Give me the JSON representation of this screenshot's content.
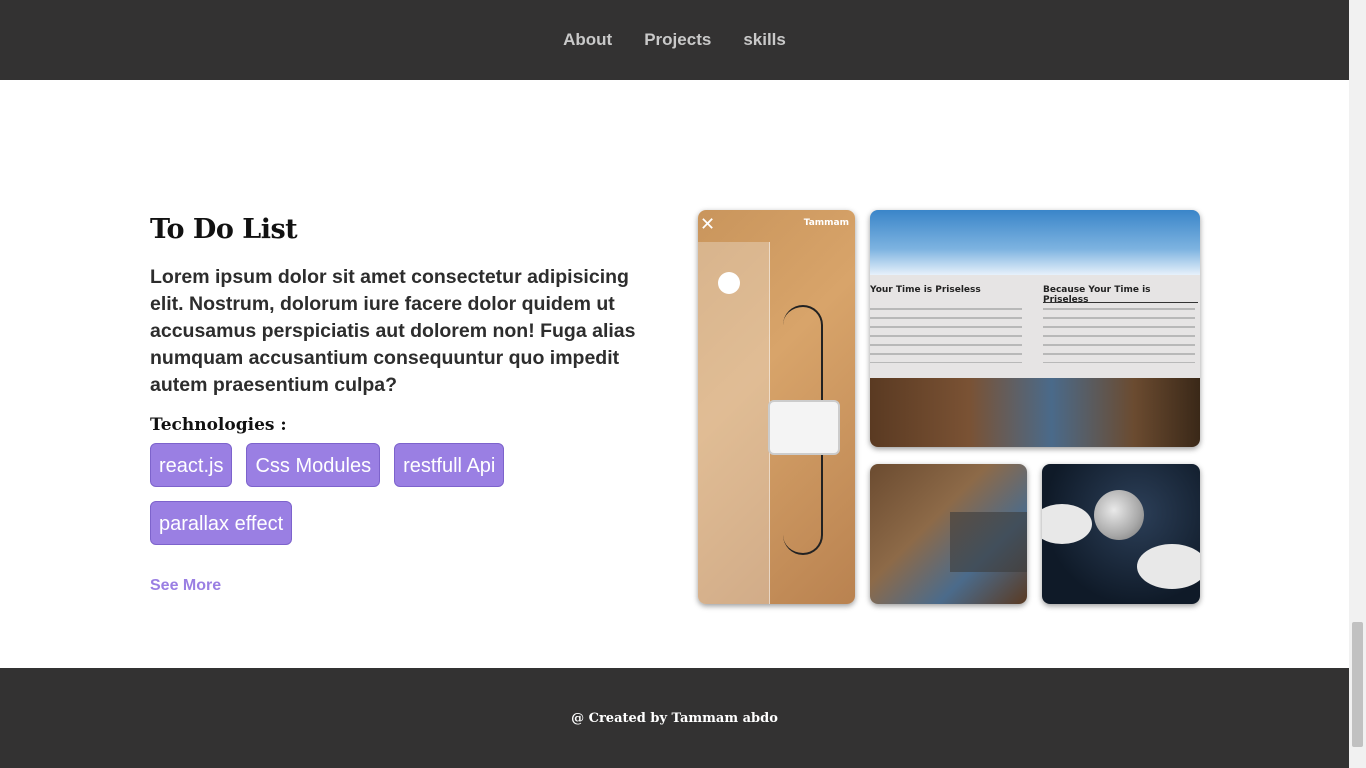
{
  "nav": {
    "links": [
      "About",
      "Projects",
      "skills"
    ]
  },
  "project": {
    "title": "To Do List",
    "description": "Lorem ipsum dolor sit amet consectetur adipisicing elit. Nostrum, dolorum iure facere dolor quidem ut accusamus perspiciatis aut dolorem non! Fuga alias numquam accusantium consequuntur quo impedit autem praesentium culpa?",
    "technologies_label": "Technologies :",
    "technologies": [
      "react.js",
      "Css Modules",
      "restfull Api",
      "parallax effect"
    ],
    "see_more": "See More"
  },
  "screenshots": {
    "mobile_watermark": "Tammam",
    "col_heading_left": "Your Time is Priseless",
    "col_heading_right": "Because Your Time is Priseless"
  },
  "footer": {
    "credit": "@ Created by Tammam abdo"
  },
  "colors": {
    "header_bg": "#333232",
    "accent": "#9a7fe3",
    "footer_bg": "#333232"
  }
}
